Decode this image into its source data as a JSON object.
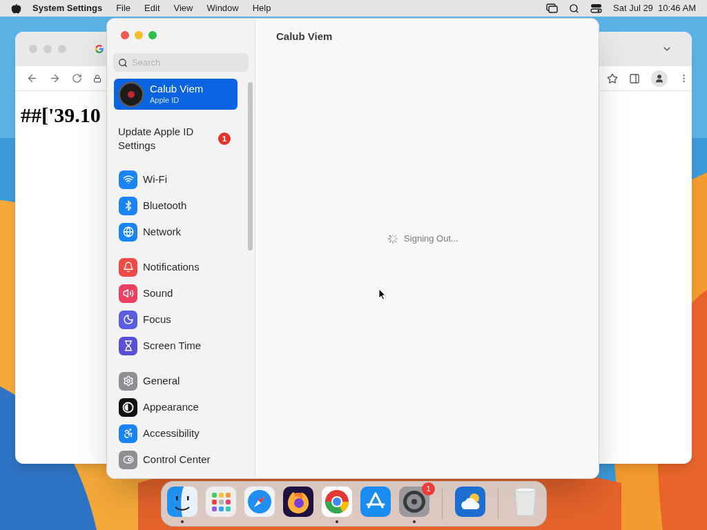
{
  "menu_bar": {
    "app": "System Settings",
    "menus": [
      "File",
      "Edit",
      "View",
      "Window",
      "Help"
    ],
    "clock": "Sat Jul 29  10:46 AM"
  },
  "browser": {
    "page_text": "##['39.10"
  },
  "settings": {
    "title": "Calub Viem",
    "search": {
      "placeholder": "Search"
    },
    "account": {
      "name": "Calub Viem",
      "subtitle": "Apple ID",
      "selected": true
    },
    "notice": {
      "label": "Update Apple ID Settings",
      "badge": "1"
    },
    "groups": [
      [
        {
          "label": "Wi-Fi",
          "kind": "wifi",
          "color": "#1a84f5",
          "selected": false
        },
        {
          "label": "Bluetooth",
          "kind": "bluetooth",
          "color": "#1a84f5",
          "selected": false
        },
        {
          "label": "Network",
          "kind": "network",
          "color": "#1a84f5",
          "selected": false
        }
      ],
      [
        {
          "label": "Notifications",
          "kind": "notifications",
          "color": "#ef4a43",
          "selected": false
        },
        {
          "label": "Sound",
          "kind": "sound",
          "color": "#ec3f62",
          "selected": false
        },
        {
          "label": "Focus",
          "kind": "focus",
          "color": "#5c5ce0",
          "selected": false
        },
        {
          "label": "Screen Time",
          "kind": "screentime",
          "color": "#5b4fd6",
          "selected": false
        }
      ],
      [
        {
          "label": "General",
          "kind": "general",
          "color": "#8e8e93",
          "selected": false
        },
        {
          "label": "Appearance",
          "kind": "appearance",
          "color": "#111111",
          "selected": false
        },
        {
          "label": "Accessibility",
          "kind": "accessibility",
          "color": "#1a84f5",
          "selected": false
        },
        {
          "label": "Control Center",
          "kind": "controlcenter",
          "color": "#8e8e93",
          "selected": false
        }
      ]
    ],
    "status": "Signing Out..."
  },
  "dock": [
    {
      "kind": "finder",
      "running": true
    },
    {
      "kind": "launchpad",
      "running": false
    },
    {
      "kind": "safari",
      "running": false
    },
    {
      "kind": "firefox",
      "running": false
    },
    {
      "kind": "chrome",
      "running": true
    },
    {
      "kind": "appstore",
      "running": false
    },
    {
      "kind": "settings",
      "running": true,
      "badge": "1"
    },
    {
      "kind": "separator"
    },
    {
      "kind": "weather",
      "running": false
    },
    {
      "kind": "separator"
    },
    {
      "kind": "trash",
      "running": false
    }
  ]
}
